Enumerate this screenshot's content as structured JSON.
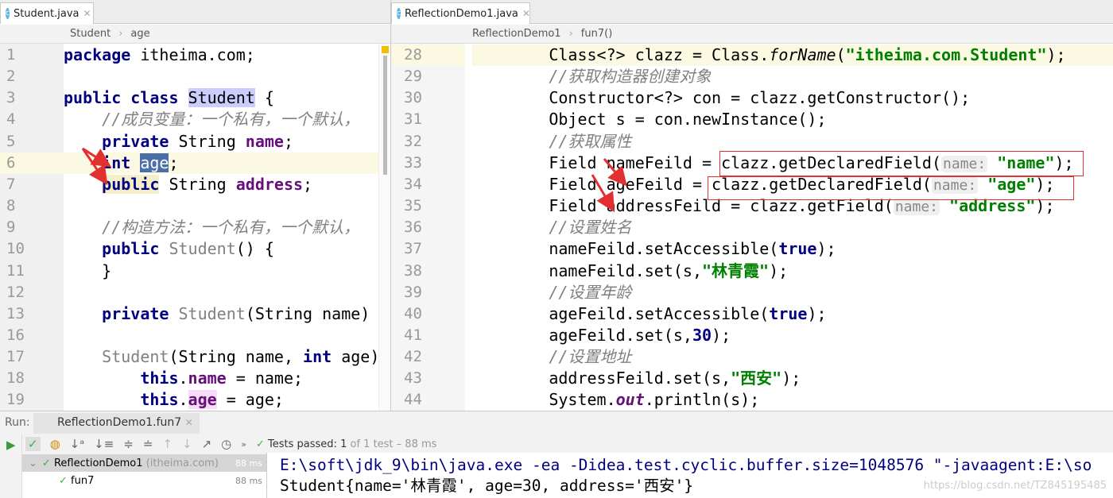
{
  "tabs": {
    "left": {
      "label": "Student.java",
      "icon": "class-icon"
    },
    "right": {
      "label": "ReflectionDemo1.java",
      "icon": "class-icon"
    }
  },
  "breadcrumbs": {
    "left": [
      "Student",
      "age"
    ],
    "right": [
      "ReflectionDemo1",
      "fun7()"
    ]
  },
  "left_editor": {
    "lines": [
      {
        "n": "1",
        "t": [
          [
            "package",
            "kw"
          ],
          [
            " itheima.com;",
            ""
          ]
        ]
      },
      {
        "n": "2",
        "t": []
      },
      {
        "n": "3",
        "t": [
          [
            "public class",
            "kw"
          ],
          [
            " ",
            ""
          ],
          [
            "Student",
            "cls"
          ],
          [
            " {",
            ""
          ]
        ]
      },
      {
        "n": "4",
        "t": [
          [
            "    //成员变量：一个私有，一个默认，",
            "cm"
          ]
        ]
      },
      {
        "n": "5",
        "t": [
          [
            "    ",
            ""
          ],
          [
            "private",
            "kw"
          ],
          [
            " String ",
            ""
          ],
          [
            "name",
            "fld"
          ],
          [
            ";",
            ""
          ]
        ]
      },
      {
        "n": "6",
        "t": [
          [
            "    ",
            ""
          ],
          [
            "int",
            "kw"
          ],
          [
            " ",
            ""
          ],
          [
            "age",
            "sel"
          ],
          [
            ";",
            ""
          ]
        ],
        "current": true
      },
      {
        "n": "7",
        "t": [
          [
            "    ",
            ""
          ],
          [
            "public",
            "kw pub"
          ],
          [
            " String ",
            ""
          ],
          [
            "address",
            "fld"
          ],
          [
            ";",
            ""
          ]
        ]
      },
      {
        "n": "8",
        "t": []
      },
      {
        "n": "9",
        "t": [
          [
            "    //构造方法：一个私有，一个默认，",
            "cm"
          ]
        ]
      },
      {
        "n": "10",
        "t": [
          [
            "    ",
            ""
          ],
          [
            "public",
            "kw"
          ],
          [
            " ",
            ""
          ],
          [
            "Student",
            "gr"
          ],
          [
            "() {",
            ""
          ]
        ]
      },
      {
        "n": "11",
        "t": [
          [
            "    }",
            ""
          ]
        ]
      },
      {
        "n": "12",
        "t": []
      },
      {
        "n": "13",
        "t": [
          [
            "    ",
            ""
          ],
          [
            "private",
            "kw"
          ],
          [
            " ",
            ""
          ],
          [
            "Student",
            "gr"
          ],
          [
            "(String name) {...}",
            ""
          ]
        ]
      },
      {
        "n": "16",
        "t": []
      },
      {
        "n": "17",
        "t": [
          [
            "    ",
            ""
          ],
          [
            "Student",
            "gr"
          ],
          [
            "(String name, ",
            ""
          ],
          [
            "int",
            "kw"
          ],
          [
            " age) {",
            ""
          ]
        ]
      },
      {
        "n": "18",
        "t": [
          [
            "        ",
            ""
          ],
          [
            "this",
            "kw"
          ],
          [
            ".",
            ""
          ],
          [
            "name",
            "fld"
          ],
          [
            " = name;",
            ""
          ]
        ]
      },
      {
        "n": "19",
        "t": [
          [
            "        ",
            ""
          ],
          [
            "this",
            "kw"
          ],
          [
            ".",
            ""
          ],
          [
            "age",
            "fld ph"
          ],
          [
            " = age;",
            ""
          ]
        ]
      }
    ]
  },
  "right_editor": {
    "lines": [
      {
        "n": "28",
        "t": [
          [
            "        Class<?> clazz = Class.",
            ""
          ],
          [
            "forName",
            "it"
          ],
          [
            "(",
            ""
          ],
          [
            "\"itheima.com.Student\"",
            "str"
          ],
          [
            ");",
            ""
          ]
        ],
        "current": true
      },
      {
        "n": "29",
        "t": [
          [
            "        //获取构造器创建对象",
            "cm"
          ]
        ]
      },
      {
        "n": "30",
        "t": [
          [
            "        Constructor<?> con = clazz.getConstructor();",
            ""
          ]
        ]
      },
      {
        "n": "31",
        "t": [
          [
            "        Object s = con.newInstance();",
            ""
          ]
        ]
      },
      {
        "n": "32",
        "t": [
          [
            "        //获取属性",
            "cm"
          ]
        ]
      },
      {
        "n": "33",
        "t": [
          [
            "        Field nameFeild = clazz.getDeclaredField(",
            ""
          ],
          [
            "name:",
            "hint"
          ],
          [
            " ",
            ""
          ],
          [
            "\"name\"",
            "str"
          ],
          [
            ");",
            ""
          ]
        ]
      },
      {
        "n": "34",
        "t": [
          [
            "        Field ageFeild = clazz.getDeclaredField(",
            ""
          ],
          [
            "name:",
            "hint"
          ],
          [
            " ",
            ""
          ],
          [
            "\"age\"",
            "str"
          ],
          [
            ");",
            ""
          ]
        ]
      },
      {
        "n": "35",
        "t": [
          [
            "        Field addressFeild = clazz.getField(",
            ""
          ],
          [
            "name:",
            "hint"
          ],
          [
            " ",
            ""
          ],
          [
            "\"address\"",
            "str"
          ],
          [
            ");",
            ""
          ]
        ]
      },
      {
        "n": "36",
        "t": [
          [
            "        //设置姓名",
            "cm"
          ]
        ]
      },
      {
        "n": "37",
        "t": [
          [
            "        nameFeild.setAccessible(",
            ""
          ],
          [
            "true",
            "kw"
          ],
          [
            ");",
            ""
          ]
        ]
      },
      {
        "n": "38",
        "t": [
          [
            "        nameFeild.set(s,",
            ""
          ],
          [
            "\"林青霞\"",
            "str"
          ],
          [
            ");",
            ""
          ]
        ]
      },
      {
        "n": "39",
        "t": [
          [
            "        //设置年龄",
            "cm"
          ]
        ]
      },
      {
        "n": "40",
        "t": [
          [
            "        ageFeild.setAccessible(",
            ""
          ],
          [
            "true",
            "kw"
          ],
          [
            ");",
            ""
          ]
        ]
      },
      {
        "n": "41",
        "t": [
          [
            "        ageFeild.set(s,",
            ""
          ],
          [
            "30",
            "kw"
          ],
          [
            ");",
            ""
          ]
        ]
      },
      {
        "n": "42",
        "t": [
          [
            "        //设置地址",
            "cm"
          ]
        ]
      },
      {
        "n": "43",
        "t": [
          [
            "        addressFeild.set(s,",
            ""
          ],
          [
            "\"西安\"",
            "str"
          ],
          [
            ");",
            ""
          ]
        ]
      },
      {
        "n": "44",
        "t": [
          [
            "        System.",
            ""
          ],
          [
            "out",
            "outf"
          ],
          [
            ".println(s);",
            ""
          ]
        ]
      }
    ]
  },
  "run": {
    "label": "Run:",
    "tab": "ReflectionDemo1.fun7",
    "status_prefix": "Tests passed:",
    "status_count": "1",
    "status_rest": "of 1 test – 88 ms",
    "tree": [
      {
        "name": "ReflectionDemo1",
        "pkg": "(itheima.com)",
        "time": "88 ms"
      },
      {
        "name": "fun7",
        "time": "88 ms"
      }
    ],
    "console": [
      "E:\\soft\\jdk_9\\bin\\java.exe -ea -Didea.test.cyclic.buffer.size=1048576 \"-javaagent:E:\\so",
      "Student{name='林青霞', age=30, address='西安'}"
    ]
  },
  "watermark": "https://blog.csdn.net/TZ845195485",
  "colors": {
    "keyword": "#000080",
    "field": "#660e7a",
    "string": "#008000",
    "annotation": "#e03030",
    "pass": "#3cb043"
  }
}
